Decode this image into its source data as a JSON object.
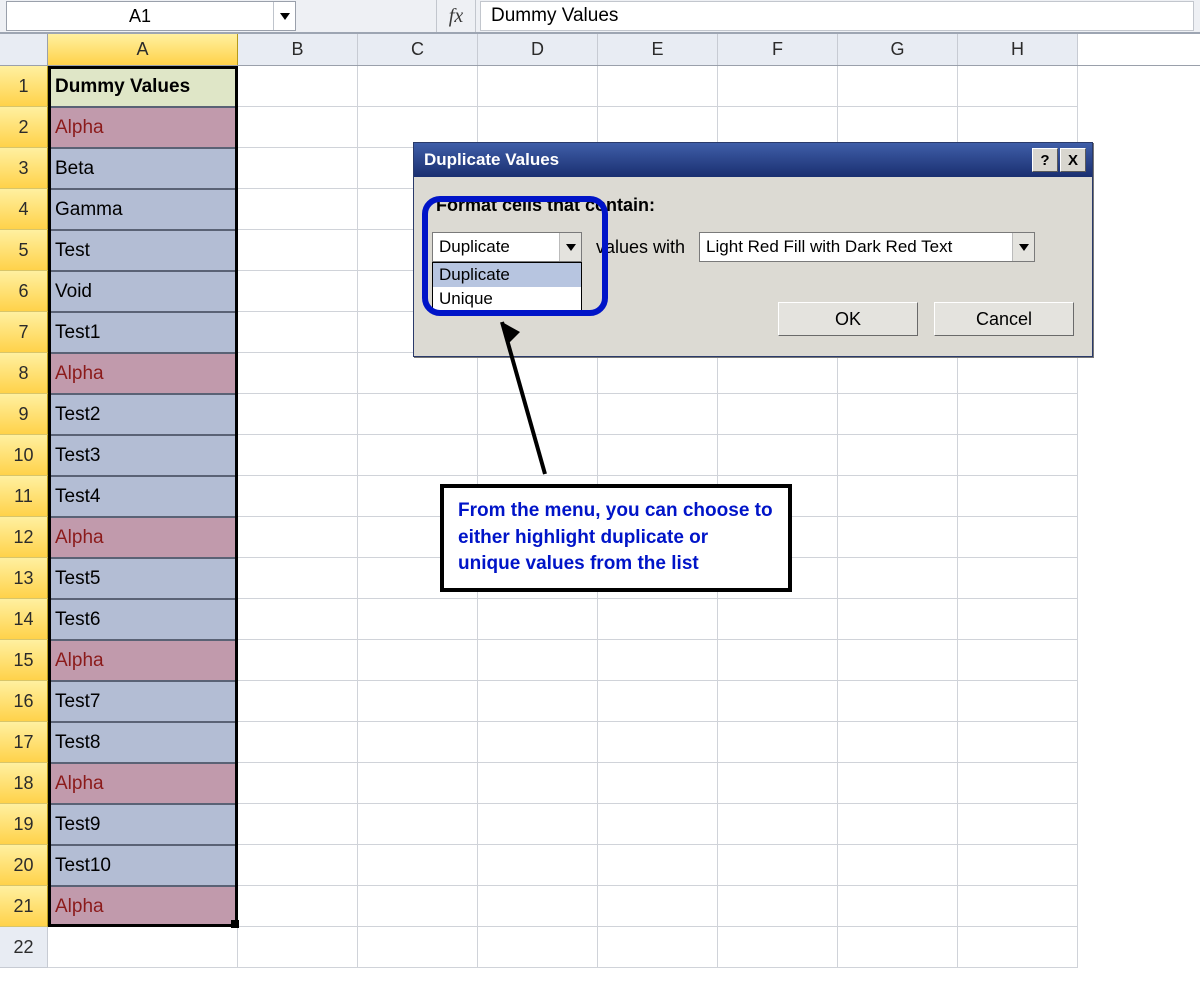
{
  "formula_bar": {
    "name_box": "A1",
    "fx_label": "fx",
    "formula": "Dummy Values"
  },
  "columns": [
    "A",
    "B",
    "C",
    "D",
    "E",
    "F",
    "G",
    "H"
  ],
  "rows": [
    {
      "n": 1,
      "a": "Dummy Values",
      "dup": false,
      "header": true
    },
    {
      "n": 2,
      "a": "Alpha",
      "dup": true
    },
    {
      "n": 3,
      "a": "Beta",
      "dup": false
    },
    {
      "n": 4,
      "a": "Gamma",
      "dup": false
    },
    {
      "n": 5,
      "a": "Test",
      "dup": false
    },
    {
      "n": 6,
      "a": "Void",
      "dup": false
    },
    {
      "n": 7,
      "a": "Test1",
      "dup": false
    },
    {
      "n": 8,
      "a": "Alpha",
      "dup": true
    },
    {
      "n": 9,
      "a": "Test2",
      "dup": false
    },
    {
      "n": 10,
      "a": "Test3",
      "dup": false
    },
    {
      "n": 11,
      "a": "Test4",
      "dup": false
    },
    {
      "n": 12,
      "a": "Alpha",
      "dup": true
    },
    {
      "n": 13,
      "a": "Test5",
      "dup": false
    },
    {
      "n": 14,
      "a": "Test6",
      "dup": false
    },
    {
      "n": 15,
      "a": "Alpha",
      "dup": true
    },
    {
      "n": 16,
      "a": "Test7",
      "dup": false
    },
    {
      "n": 17,
      "a": "Test8",
      "dup": false
    },
    {
      "n": 18,
      "a": "Alpha",
      "dup": true
    },
    {
      "n": 19,
      "a": "Test9",
      "dup": false
    },
    {
      "n": 20,
      "a": "Test10",
      "dup": false
    },
    {
      "n": 21,
      "a": "Alpha",
      "dup": true
    }
  ],
  "dialog": {
    "title": "Duplicate Values",
    "help": "?",
    "close": "X",
    "prompt": "Format cells that contain:",
    "type_select": {
      "value": "Duplicate",
      "options": [
        "Duplicate",
        "Unique"
      ]
    },
    "middle_label": "values with",
    "format_select": {
      "value": "Light Red Fill with Dark Red Text"
    },
    "ok": "OK",
    "cancel": "Cancel"
  },
  "annotation": "From the menu, you can choose to either highlight duplicate or unique values from the list",
  "colors": {
    "accent_blue": "#0014c8",
    "dup_fill": "#c19aac",
    "dup_text": "#8b1a1a",
    "sel_fill": "#b3bdd4"
  }
}
